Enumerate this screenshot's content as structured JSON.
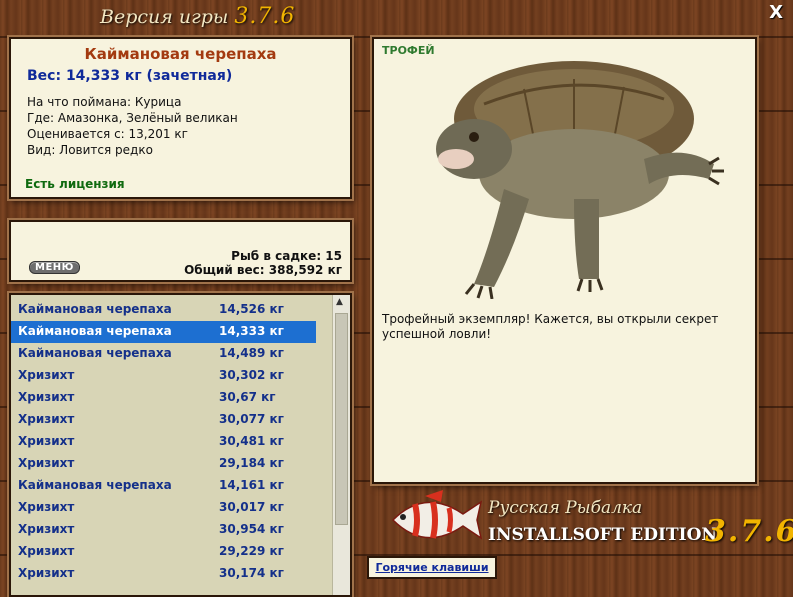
{
  "window": {
    "title_prefix": "Версия игры",
    "version": "3.7.6",
    "close_label": "X"
  },
  "catch_info": {
    "name": "Каймановая черепаха",
    "weight": "Вес: 14,333 кг (зачетная)",
    "bait": "На что поймана: Курица",
    "location": "Где: Амазонка, Зелёный великан",
    "valued_from": "Оценивается с: 13,201 кг",
    "rarity": "Вид: Ловится редко",
    "license": "Есть лицензия"
  },
  "status": {
    "menu_label": "МЕНЮ",
    "fish_count": "Рыб в садке: 15",
    "total_weight": "Общий вес: 388,592 кг"
  },
  "fish_list": [
    {
      "name": "Каймановая черепаха",
      "weight": "14,526 кг"
    },
    {
      "name": "Каймановая черепаха",
      "weight": "14,333 кг"
    },
    {
      "name": "Каймановая черепаха",
      "weight": "14,489 кг"
    },
    {
      "name": "Хризихт",
      "weight": "30,302 кг"
    },
    {
      "name": "Хризихт",
      "weight": "30,67 кг"
    },
    {
      "name": "Хризихт",
      "weight": "30,077 кг"
    },
    {
      "name": "Хризихт",
      "weight": "30,481 кг"
    },
    {
      "name": "Хризихт",
      "weight": "29,184 кг"
    },
    {
      "name": "Каймановая черепаха",
      "weight": "14,161 кг"
    },
    {
      "name": "Хризихт",
      "weight": "30,017 кг"
    },
    {
      "name": "Хризихт",
      "weight": "30,954 кг"
    },
    {
      "name": "Хризихт",
      "weight": "29,229 кг"
    },
    {
      "name": "Хризихт",
      "weight": "30,174 кг"
    }
  ],
  "trophy": {
    "label": "ТРОФЕЙ",
    "message": "Трофейный экземпляр! Кажется, вы открыли секрет успешной ловли!"
  },
  "brand": {
    "game_name": "Русская Рыбалка",
    "edition": "INSTALLSOFT EDITION",
    "version": "3.7.6"
  },
  "hotkeys_label": "Горячие клавиши",
  "icons": {
    "close": "close-icon",
    "scroll_up": "scroll-up-arrow-icon",
    "turtle": "turtle-image",
    "fish_logo": "fish-logo-icon"
  },
  "colors": {
    "fish_name": "#a33a10",
    "weight": "#102a9a",
    "license": "#0f6a0f",
    "selection": "#1d6fd1",
    "version_gold": "#f2b400"
  }
}
